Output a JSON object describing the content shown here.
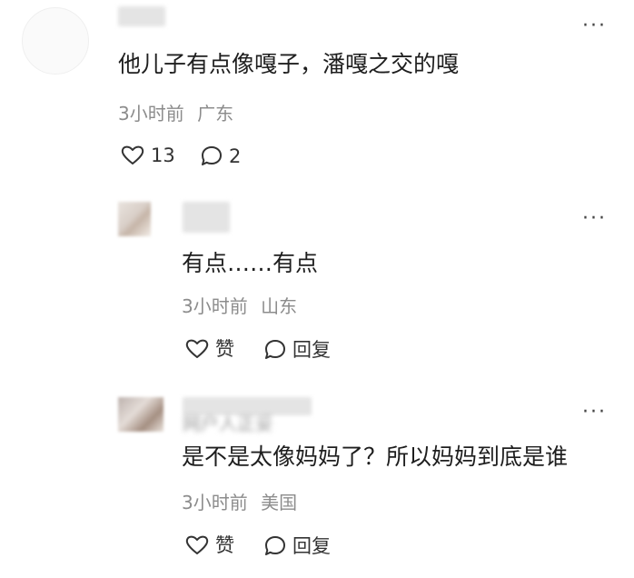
{
  "comments": [
    {
      "text": "他儿子有点像嘎子，潘嘎之交的嘎",
      "time": "3小时前",
      "location": "广东",
      "like_count": "13",
      "reply_count": "2"
    },
    {
      "text": "有点……有点",
      "time": "3小时前",
      "location": "山东",
      "like_label": "赞",
      "reply_label": "回复"
    },
    {
      "username_blurred": "网户人正妥",
      "text": "是不是太像妈妈了？所以妈妈到底是谁",
      "time": "3小时前",
      "location": "美国",
      "like_label": "赞",
      "reply_label": "回复"
    }
  ],
  "more_symbol": "···"
}
